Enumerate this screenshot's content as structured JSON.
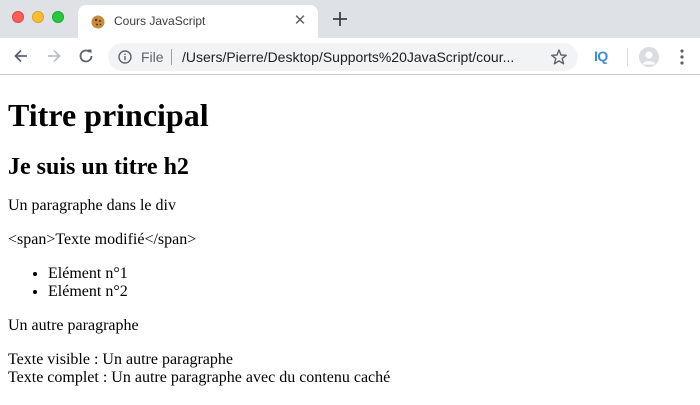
{
  "browser": {
    "tab": {
      "title": "Cours JavaScript"
    },
    "omnibox": {
      "scheme_label": "File",
      "url": "/Users/Pierre/Desktop/Supports%20JavaScript/cour..."
    },
    "extension_label": "IQ"
  },
  "page": {
    "h1": "Titre principal",
    "h2": "Je suis un titre h2",
    "paragraph_div": "Un paragraphe dans le div",
    "span_text": "<span>Texte modifié</span>",
    "list_items": [
      "Elément n°1",
      "Elément n°2"
    ],
    "paragraph_other": "Un autre paragraphe",
    "visible_text_line": "Texte visible : Un autre paragraphe",
    "full_text_line": "Texte complet : Un autre paragraphe avec du contenu caché"
  },
  "colors": {
    "tab_strip": "#dee1e6",
    "omnibox": "#f1f3f4",
    "extension_accent": "#3d8bd9"
  }
}
